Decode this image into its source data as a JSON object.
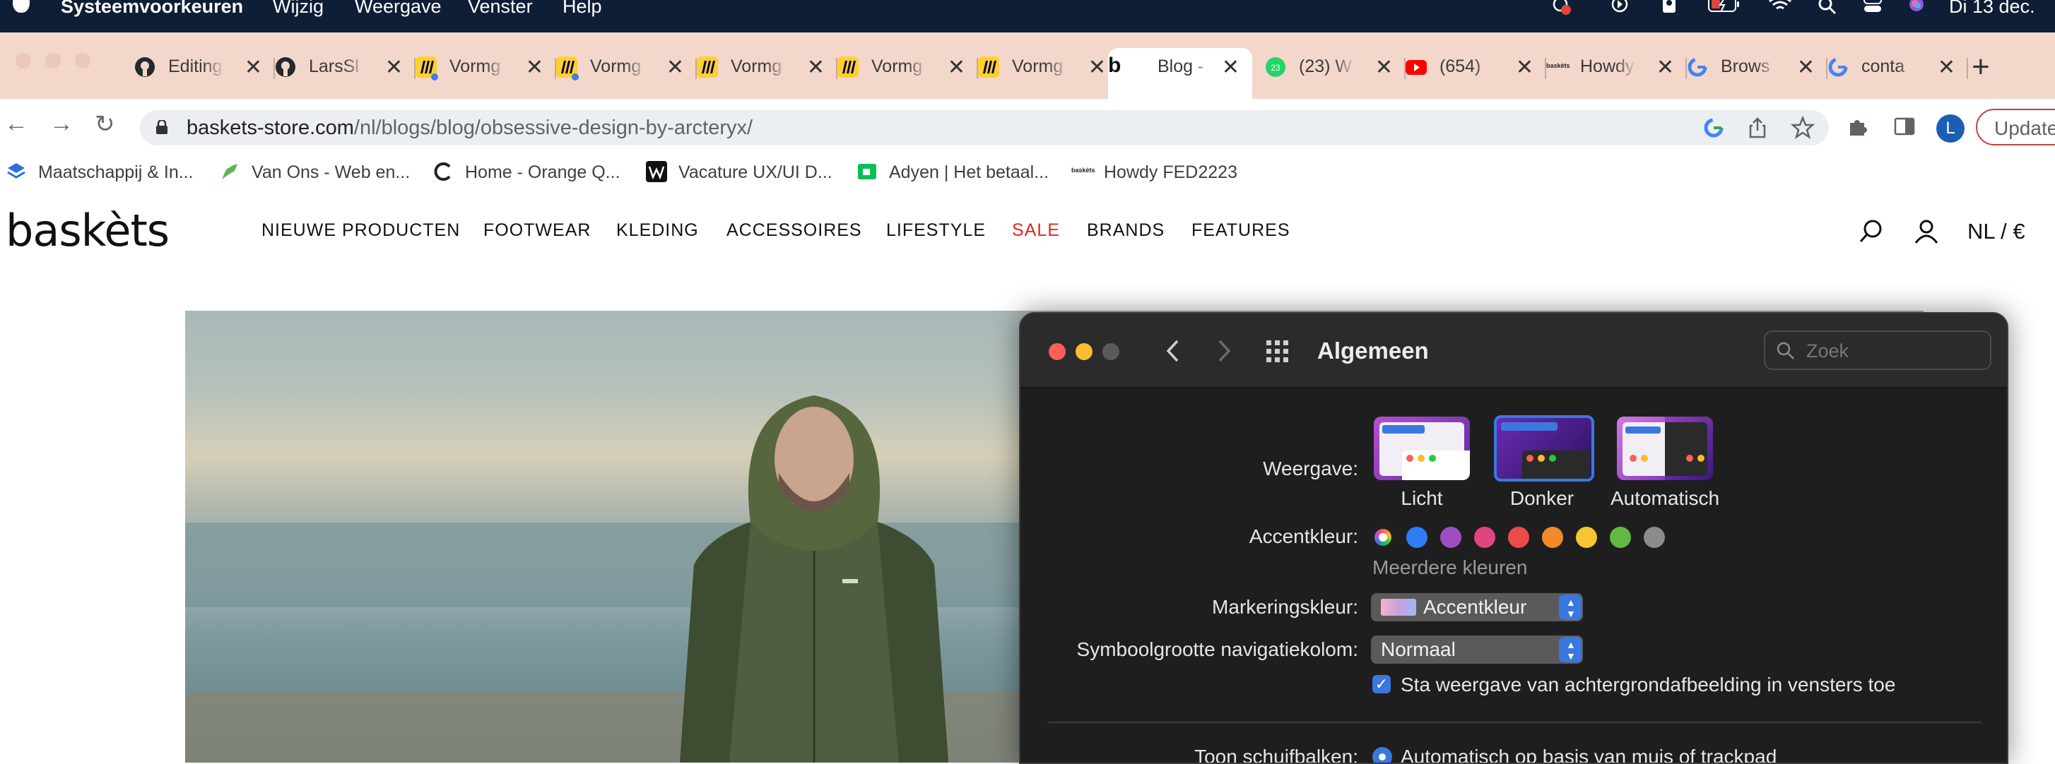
{
  "menubar": {
    "app_name": "Systeemvoorkeuren",
    "items": [
      "Wijzig",
      "Weergave",
      "Venster",
      "Help"
    ],
    "clock": "Di 13 dec."
  },
  "tabs": [
    {
      "title": "Editing",
      "favicon": "github-icon"
    },
    {
      "title": "LarsSl",
      "favicon": "github-icon"
    },
    {
      "title": "Vormg",
      "favicon": "miro-icon"
    },
    {
      "title": "Vormg",
      "favicon": "miro-icon"
    },
    {
      "title": "Vormg",
      "favicon": "miro-icon"
    },
    {
      "title": "Vormg",
      "favicon": "miro-icon"
    },
    {
      "title": "Vormg",
      "favicon": "miro-icon"
    },
    {
      "title": "Blog -",
      "favicon": "baskets-icon",
      "active": true
    },
    {
      "title": "(23) W",
      "favicon": "whatsapp-icon"
    },
    {
      "title": "(654)",
      "favicon": "youtube-icon"
    },
    {
      "title": "Howdy",
      "favicon": "baskets-icon"
    },
    {
      "title": "Brows",
      "favicon": "google-icon"
    },
    {
      "title": "conta",
      "favicon": "google-icon"
    }
  ],
  "address": {
    "domain": "baskets-store.com",
    "path": "/nl/blogs/blog/obsessive-design-by-arcteryx/"
  },
  "profile_initial": "L",
  "update_label": "Update",
  "bookmarks": [
    "Maatschappij & In...",
    "Van Ons - Web en...",
    "Home - Orange Q...",
    "Vacature UX/UI D...",
    "Adyen | Het betaal...",
    "Howdy FED2223"
  ],
  "site": {
    "logo": "baskèts",
    "nav": [
      "NIEUWE PRODUCTEN",
      "FOOTWEAR",
      "KLEDING",
      "ACCESSOIRES",
      "LIFESTYLE",
      "SALE",
      "BRANDS",
      "FEATURES"
    ],
    "currency": "NL / €"
  },
  "prefs": {
    "title": "Algemeen",
    "search_placeholder": "Zoek",
    "appearance_label": "Weergave:",
    "appearance_options": [
      "Licht",
      "Donker",
      "Automatisch"
    ],
    "appearance_selected": "Donker",
    "accent_label": "Accentkleur:",
    "accent_colors": [
      "#2f7cf6",
      "#9d4fc1",
      "#e0457f",
      "#ec4c49",
      "#f08a2b",
      "#f5c532",
      "#62b946",
      "#8c8c8c"
    ],
    "accent_more": "Meerdere kleuren",
    "highlight_label": "Markeringskleur:",
    "highlight_value": "Accentkleur",
    "sidebar_icon_label": "Symboolgrootte navigatiekolom:",
    "sidebar_icon_value": "Normaal",
    "wallpaper_tinting": "Sta weergave van achtergrondafbeelding in vensters toe",
    "scrollbars_label": "Toon schuifbalken:",
    "scrollbars_value": "Automatisch op basis van muis of trackpad"
  }
}
